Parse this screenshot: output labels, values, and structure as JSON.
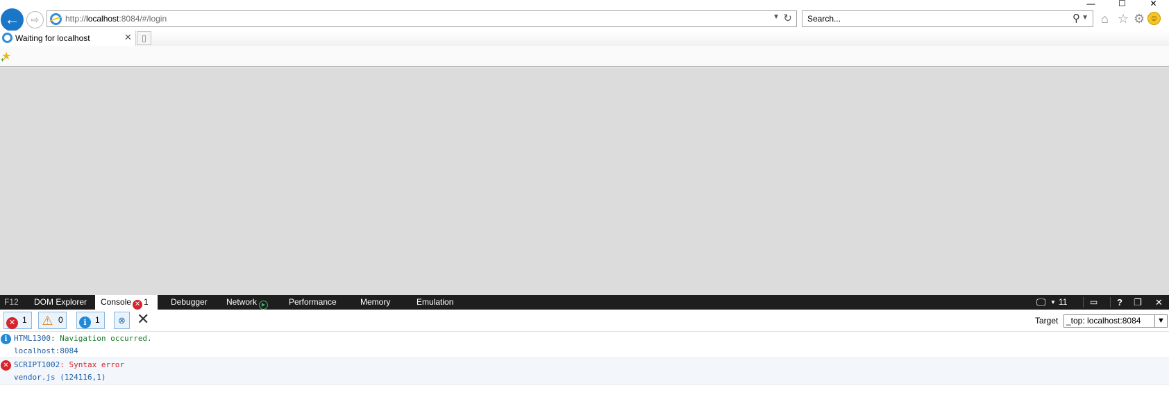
{
  "window": {
    "minimize": "—",
    "maximize": "☐",
    "close": "✕"
  },
  "address": {
    "url_prefix": "http://",
    "url_host": "localhost",
    "url_rest": ":8084/#/login",
    "search_placeholder": "Search..."
  },
  "tabs": [
    {
      "title": "Waiting for localhost"
    }
  ],
  "devtools": {
    "tabs": [
      {
        "label": "F12"
      },
      {
        "label": "DOM Explorer"
      },
      {
        "label": "Console",
        "badge": "1"
      },
      {
        "label": "Debugger"
      },
      {
        "label": "Network"
      },
      {
        "label": "Performance"
      },
      {
        "label": "Memory"
      },
      {
        "label": "Emulation"
      }
    ],
    "doc_mode": "11",
    "help": "?"
  },
  "console": {
    "filters": {
      "errors": "1",
      "warnings": "0",
      "info": "1"
    },
    "target_label": "Target",
    "target_value": "_top: localhost:8084",
    "messages": [
      {
        "type": "info",
        "code": "HTML1300",
        "text": ": Navigation occurred.",
        "source": "localhost:8084"
      },
      {
        "type": "error",
        "code": "SCRIPT1002",
        "text": ": Syntax error",
        "source": "vendor.js (124116,1)"
      }
    ]
  },
  "colors": {
    "devtools_bar": "#1e1e1e",
    "content_bg": "#dcdcdc",
    "error": "#d8232a",
    "info": "#1f8ad8",
    "warning": "#e07b17",
    "link_blue": "#1f5fa6",
    "success_green": "#1d7a2a"
  }
}
